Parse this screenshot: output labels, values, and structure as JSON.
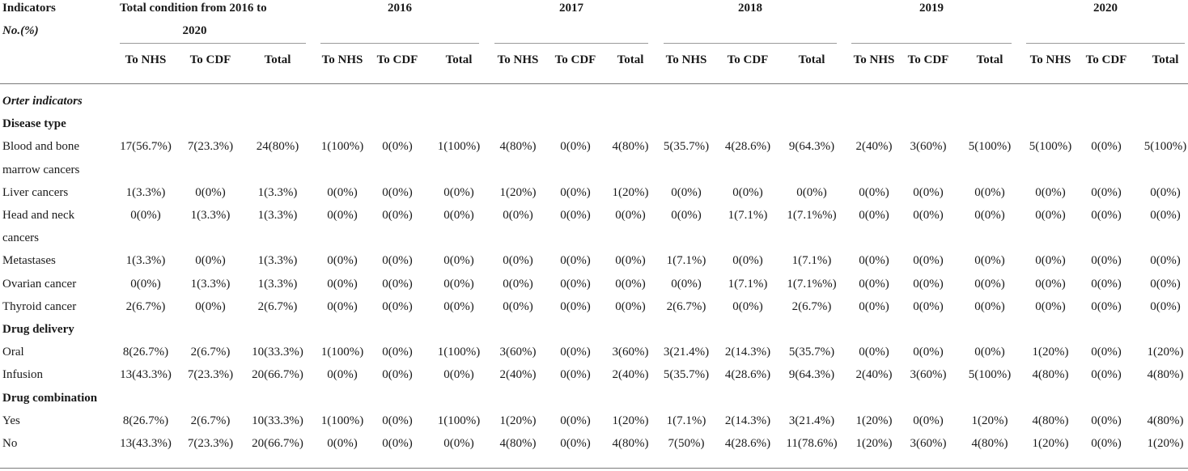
{
  "header": {
    "indicators_label": "Indicators",
    "no_pct_label": "No.(%)",
    "total_group_line1": "Total condition from 2016 to",
    "total_group_line2": "2020",
    "years": [
      "2016",
      "2017",
      "2018",
      "2019",
      "2020"
    ],
    "sub_cols": [
      "To NHS",
      "To CDF",
      "Total"
    ]
  },
  "sections": [
    {
      "type": "italic-heading",
      "label": "Orter indicators"
    },
    {
      "type": "bold-heading",
      "label": "Disease type"
    },
    {
      "type": "data",
      "label_line1": "Blood and bone",
      "label_line2": "marrow cancers",
      "cells": [
        "17(56.7%)",
        "7(23.3%)",
        "24(80%)",
        "1(100%)",
        "0(0%)",
        "1(100%)",
        "4(80%)",
        "0(0%)",
        "4(80%)",
        "5(35.7%)",
        "4(28.6%)",
        "9(64.3%)",
        "2(40%)",
        "3(60%)",
        "5(100%)",
        "5(100%)",
        "0(0%)",
        "5(100%)"
      ]
    },
    {
      "type": "data",
      "label_line1": "Liver cancers",
      "cells": [
        "1(3.3%)",
        "0(0%)",
        "1(3.3%)",
        "0(0%)",
        "0(0%)",
        "0(0%)",
        "1(20%)",
        "0(0%)",
        "1(20%)",
        "0(0%)",
        "0(0%)",
        "0(0%)",
        "0(0%)",
        "0(0%)",
        "0(0%)",
        "0(0%)",
        "0(0%)",
        "0(0%)"
      ]
    },
    {
      "type": "data",
      "label_line1": "Head and neck",
      "label_line2": "cancers",
      "cells": [
        "0(0%)",
        "1(3.3%)",
        "1(3.3%)",
        "0(0%)",
        "0(0%)",
        "0(0%)",
        "0(0%)",
        "0(0%)",
        "0(0%)",
        "0(0%)",
        "1(7.1%)",
        "1(7.1%%)",
        "0(0%)",
        "0(0%)",
        "0(0%)",
        "0(0%)",
        "0(0%)",
        "0(0%)"
      ]
    },
    {
      "type": "data",
      "label_line1": "Metastases",
      "cells": [
        "1(3.3%)",
        "0(0%)",
        "1(3.3%)",
        "0(0%)",
        "0(0%)",
        "0(0%)",
        "0(0%)",
        "0(0%)",
        "0(0%)",
        "1(7.1%)",
        "0(0%)",
        "1(7.1%)",
        "0(0%)",
        "0(0%)",
        "0(0%)",
        "0(0%)",
        "0(0%)",
        "0(0%)"
      ]
    },
    {
      "type": "data",
      "label_line1": "Ovarian cancer",
      "cells": [
        "0(0%)",
        "1(3.3%)",
        "1(3.3%)",
        "0(0%)",
        "0(0%)",
        "0(0%)",
        "0(0%)",
        "0(0%)",
        "0(0%)",
        "0(0%)",
        "1(7.1%)",
        "1(7.1%%)",
        "0(0%)",
        "0(0%)",
        "0(0%)",
        "0(0%)",
        "0(0%)",
        "0(0%)"
      ]
    },
    {
      "type": "data",
      "label_line1": "Thyroid cancer",
      "cells": [
        "2(6.7%)",
        "0(0%)",
        "2(6.7%)",
        "0(0%)",
        "0(0%)",
        "0(0%)",
        "0(0%)",
        "0(0%)",
        "0(0%)",
        "2(6.7%)",
        "0(0%)",
        "2(6.7%)",
        "0(0%)",
        "0(0%)",
        "0(0%)",
        "0(0%)",
        "0(0%)",
        "0(0%)"
      ]
    },
    {
      "type": "bold-heading",
      "label": "Drug delivery"
    },
    {
      "type": "data",
      "label_line1": "Oral",
      "cells": [
        "8(26.7%)",
        "2(6.7%)",
        "10(33.3%)",
        "1(100%)",
        "0(0%)",
        "1(100%)",
        "3(60%)",
        "0(0%)",
        "3(60%)",
        "3(21.4%)",
        "2(14.3%)",
        "5(35.7%)",
        "0(0%)",
        "0(0%)",
        "0(0%)",
        "1(20%)",
        "0(0%)",
        "1(20%)"
      ]
    },
    {
      "type": "data",
      "label_line1": "Infusion",
      "cells": [
        "13(43.3%)",
        "7(23.3%)",
        "20(66.7%)",
        "0(0%)",
        "0(0%)",
        "0(0%)",
        "2(40%)",
        "0(0%)",
        "2(40%)",
        "5(35.7%)",
        "4(28.6%)",
        "9(64.3%)",
        "2(40%)",
        "3(60%)",
        "5(100%)",
        "4(80%)",
        "0(0%)",
        "4(80%)"
      ]
    },
    {
      "type": "bold-heading",
      "label": "Drug combination"
    },
    {
      "type": "data",
      "label_line1": "Yes",
      "cells": [
        "8(26.7%)",
        "2(6.7%)",
        "10(33.3%)",
        "1(100%)",
        "0(0%)",
        "1(100%)",
        "1(20%)",
        "0(0%)",
        "1(20%)",
        "1(7.1%)",
        "2(14.3%)",
        "3(21.4%)",
        "1(20%)",
        "0(0%)",
        "1(20%)",
        "4(80%)",
        "0(0%)",
        "4(80%)"
      ]
    },
    {
      "type": "data",
      "label_line1": "No",
      "cells": [
        "13(43.3%)",
        "7(23.3%)",
        "20(66.7%)",
        "0(0%)",
        "0(0%)",
        "0(0%)",
        "4(80%)",
        "0(0%)",
        "4(80%)",
        "7(50%)",
        "4(28.6%)",
        "11(78.6%)",
        "1(20%)",
        "3(60%)",
        "4(80%)",
        "1(20%)",
        "0(0%)",
        "1(20%)"
      ]
    }
  ]
}
